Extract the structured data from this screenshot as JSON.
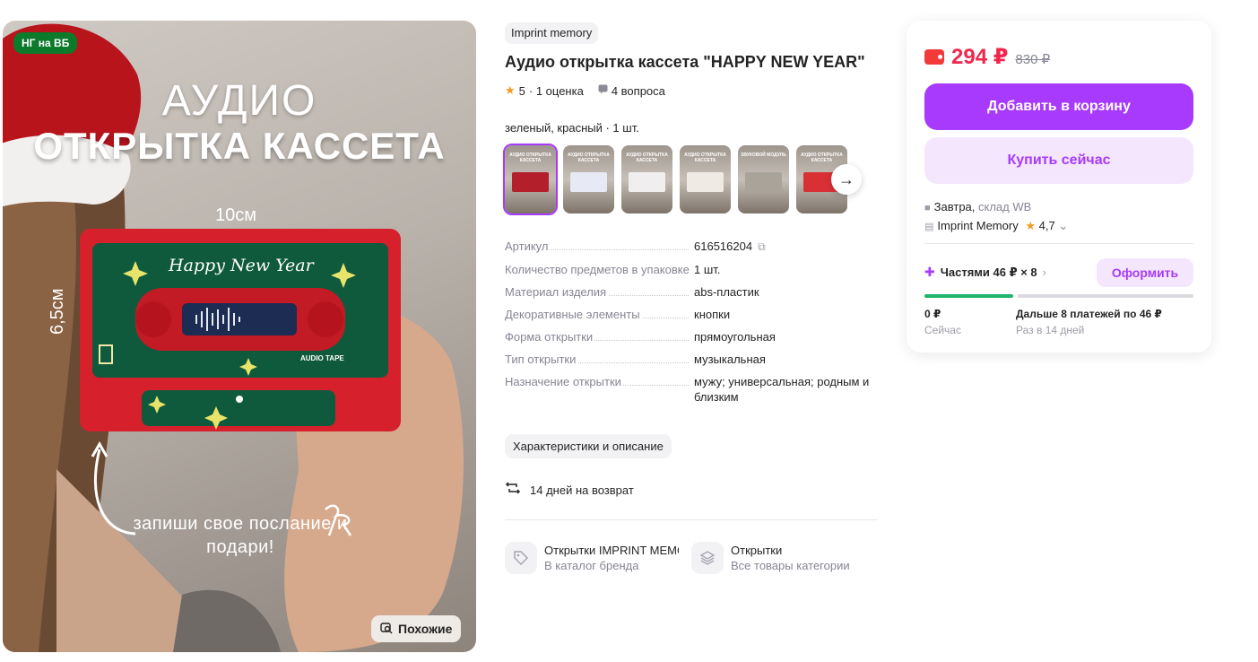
{
  "image": {
    "badge": "НГ на ВБ",
    "title_line1": "АУДИО",
    "title_line2": "ОТКРЫТКА КАССЕТА",
    "width_label": "10см",
    "height_label": "6,5см",
    "cassette_text": "Happy New Year",
    "cassette_tape_label": "AUDIO TAPE",
    "caption": "запиши свое послание и подари!",
    "similar_label": "Похожие"
  },
  "product": {
    "brand": "Imprint memory",
    "title": "Аудио открытка кассета \"HAPPY NEW YEAR\"",
    "rating": "5",
    "reviews": "· 1 оценка",
    "questions": "4 вопроса",
    "variant": "зеленый, красный · 1 шт."
  },
  "thumbnails": [
    {
      "caption": "АУДИО ОТКРЫТКА КАССЕТА",
      "accent": "#b31f2a"
    },
    {
      "caption": "АУДИО ОТКРЫТКА КАССЕТА",
      "accent": "#e7e9f4"
    },
    {
      "caption": "АУДИО ОТКРЫТКА КАССЕТА",
      "accent": "#f1eef0"
    },
    {
      "caption": "АУДИО ОТКРЫТКА КАССЕТА",
      "accent": "#efeae4"
    },
    {
      "caption": "ЗВУКОВОЙ МОДУЛЬ",
      "accent": "#a9a39a"
    },
    {
      "caption": "АУДИО ОТКРЫТКА КАССЕТА",
      "accent": "#d93036"
    }
  ],
  "specs": [
    {
      "name": "Артикул",
      "value": "616516204"
    },
    {
      "name": "Количество предметов в упаковке",
      "value": "1 шт."
    },
    {
      "name": "Материал изделия",
      "value": "abs-пластик"
    },
    {
      "name": "Декоративные элементы",
      "value": "кнопки"
    },
    {
      "name": "Форма открытки",
      "value": "прямоугольная"
    },
    {
      "name": "Тип открытки",
      "value": "музыкальная"
    },
    {
      "name": "Назначение открытки",
      "value": "мужу; универсальная; родным и близким"
    }
  ],
  "description_button": "Характеристики и описание",
  "return_text": "14 дней на возврат",
  "links": [
    {
      "title": "Открытки IMPRINT MEMORY",
      "sub": "В каталог бренда"
    },
    {
      "title": "Открытки",
      "sub": "Все товары категории"
    }
  ],
  "buy": {
    "price": "294 ₽",
    "old_price": "830 ₽",
    "add_to_cart": "Добавить в корзину",
    "buy_now": "Купить сейчас",
    "delivery_day": "Завтра,",
    "delivery_warehouse": "склад WB",
    "seller": "Imprint Memory",
    "seller_rating": "4,7",
    "installments": "Частями 46 ₽ × 8",
    "installments_button": "Оформить",
    "installments_progress": 0.33,
    "pay_now_value": "0 ₽",
    "pay_now_label": "Сейчас",
    "pay_later_value": "Дальше 8 платежей по 46 ₽",
    "pay_later_label": "Раз в 14 дней"
  },
  "colors": {
    "accent": "#a73afd",
    "price": "#f0264d",
    "badge": "#0b7a2a",
    "progress": "#1db46d"
  }
}
